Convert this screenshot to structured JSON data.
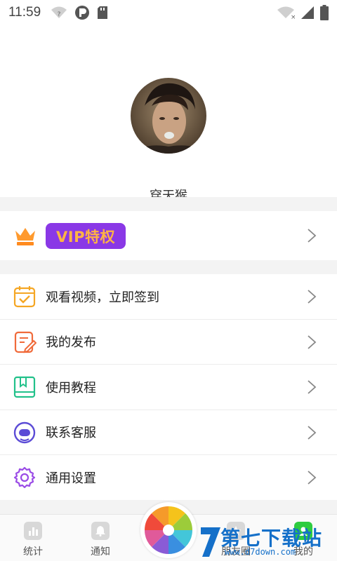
{
  "status_bar": {
    "time": "11:59",
    "left_icons": [
      "wifi-question-icon",
      "p-circle-icon",
      "sd-card-icon"
    ],
    "right_icons": [
      "wifi-off-icon",
      "signal-icon",
      "battery-icon"
    ]
  },
  "profile": {
    "username": "穿天猴"
  },
  "vip": {
    "label": "VIP特权",
    "icon": "crown-icon",
    "badge_color": "#8a38e6",
    "text_color": "#ffb443"
  },
  "menu": {
    "items": [
      {
        "label": "观看视频，立即签到",
        "icon": "calendar-check-icon",
        "color": "#f5a623"
      },
      {
        "label": "我的发布",
        "icon": "edit-document-icon",
        "color": "#f06a3a"
      },
      {
        "label": "使用教程",
        "icon": "book-icon",
        "color": "#21c18a"
      },
      {
        "label": "联系客服",
        "icon": "customer-service-icon",
        "color": "#5b4bd6"
      },
      {
        "label": "通用设置",
        "icon": "gear-icon",
        "color": "#9a4be6"
      }
    ]
  },
  "bottom_nav": {
    "items": [
      {
        "label": "统计",
        "icon": "chart-icon"
      },
      {
        "label": "通知",
        "icon": "bell-icon"
      },
      {
        "label": "",
        "icon": "color-wheel-icon"
      },
      {
        "label": "朋友圈",
        "icon": "star-icon"
      },
      {
        "label": "我的",
        "icon": "user-icon"
      }
    ]
  },
  "watermark": {
    "text": "第七下载站",
    "url": "www.d7down.com"
  }
}
